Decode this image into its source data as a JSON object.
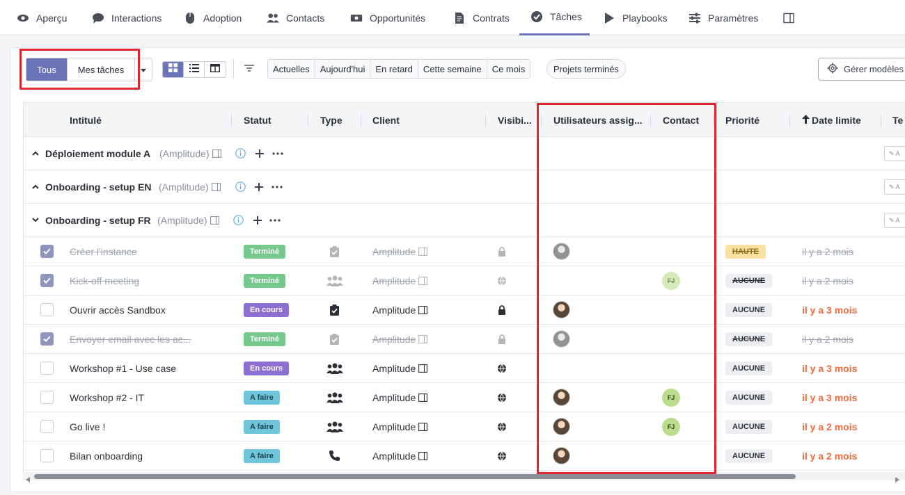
{
  "nav": {
    "items": [
      {
        "label": "Aperçu",
        "icon": "eye-icon"
      },
      {
        "label": "Interactions",
        "icon": "chat-bubble-icon"
      },
      {
        "label": "Adoption",
        "icon": "mouse-icon"
      },
      {
        "label": "Contacts",
        "icon": "users-icon"
      },
      {
        "label": "Opportunités",
        "icon": "money-bill-icon"
      },
      {
        "label": "Contrats",
        "icon": "file-contract-icon"
      },
      {
        "label": "Tâches",
        "icon": "check-circle-icon"
      },
      {
        "label": "Playbooks",
        "icon": "play-icon"
      },
      {
        "label": "Paramètres",
        "icon": "sliders-icon"
      }
    ],
    "active": "Tâches",
    "accent": "#6c74b8"
  },
  "toolbar": {
    "filter_all": "Tous",
    "filter_mine": "Mes tâches",
    "chips": [
      "Actuelles",
      "Aujourd'hui",
      "En retard",
      "Cette semaine",
      "Ce mois"
    ],
    "projects_done": "Projets terminés",
    "manage_models": "Gérer modèles"
  },
  "table": {
    "headers": {
      "title": "Intitulé",
      "status": "Statut",
      "type": "Type",
      "client": "Client",
      "visibility": "Visibi...",
      "assignees": "Utilisateurs assig...",
      "contact": "Contact",
      "priority": "Priorité",
      "due": "Date limite",
      "extra": "Te"
    },
    "groups": [
      {
        "title": "Déploiement module A",
        "client": "(Amplitude)"
      },
      {
        "title": "Onboarding - setup EN",
        "client": "(Amplitude)"
      },
      {
        "title": "Onboarding - setup FR",
        "client": "(Amplitude)"
      }
    ],
    "tasks": [
      {
        "title": "Créer l'instance",
        "status": "Terminé",
        "client": "Amplitude",
        "priority": "HAUTE",
        "due": "il y a 2 mois",
        "done": true
      },
      {
        "title": "Kick-off meeting",
        "status": "Terminé",
        "client": "Amplitude",
        "contact": "FJ",
        "priority": "AUCUNE",
        "due": "il y a 2 mois",
        "done": true
      },
      {
        "title": "Ouvrir accès Sandbox",
        "status": "En cours",
        "client": "Amplitude",
        "priority": "AUCUNE",
        "due": "il y a 3 mois",
        "done": false
      },
      {
        "title": "Envoyer email avec les ac...",
        "status": "Terminé",
        "client": "Amplitude",
        "priority": "AUCUNE",
        "due": "il y a 2 mois",
        "done": true
      },
      {
        "title": "Workshop #1 - Use case",
        "status": "En cours",
        "client": "Amplitude",
        "priority": "AUCUNE",
        "due": "il y a 3 mois",
        "done": false
      },
      {
        "title": "Workshop #2 - IT",
        "status": "A faire",
        "client": "Amplitude",
        "contact": "FJ",
        "priority": "AUCUNE",
        "due": "il y a 3 mois",
        "done": false
      },
      {
        "title": "Go live !",
        "status": "A faire",
        "client": "Amplitude",
        "contact": "FJ",
        "priority": "AUCUNE",
        "due": "il y a 2 mois",
        "done": false
      },
      {
        "title": "Bilan onboarding",
        "status": "A faire",
        "client": "Amplitude",
        "priority": "AUCUNE",
        "due": "il y a 2 mois",
        "done": false
      }
    ]
  },
  "colors": {
    "done": "#5ec07a",
    "in_progress": "#8c6fd0",
    "todo": "#6fc6dc",
    "late": "#f16a3a",
    "highlight": "#e3262d"
  }
}
